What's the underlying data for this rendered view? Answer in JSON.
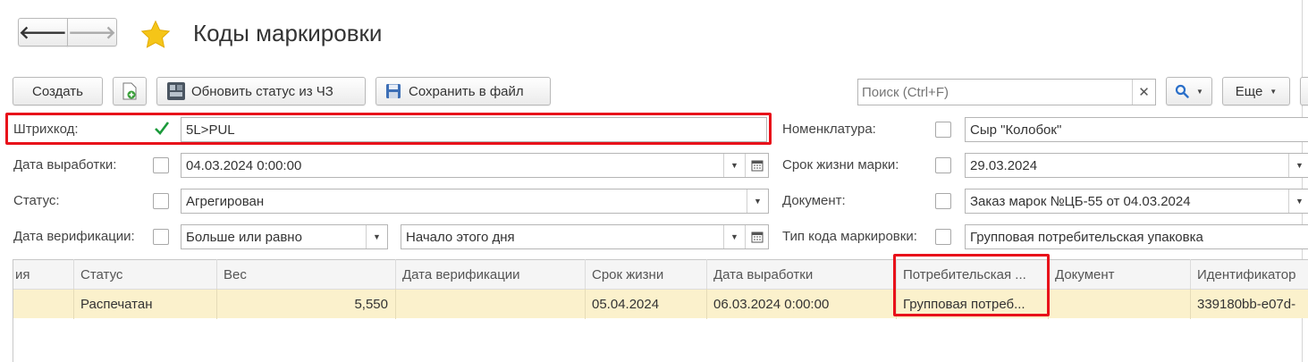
{
  "window": {
    "title": "Коды маркировки"
  },
  "nav": {
    "back": "🡐",
    "forward": "🡒"
  },
  "toolbar": {
    "create_label": "Создать",
    "update_status_label": "Обновить статус из ЧЗ",
    "save_file_label": "Сохранить в файл",
    "search_placeholder": "Поиск (Ctrl+F)",
    "more_label": "Еще"
  },
  "filters": {
    "barcode": {
      "label": "Штрихкод:",
      "value": "5L>PUL",
      "checked": true
    },
    "production_date": {
      "label": "Дата выработки:",
      "value": "04.03.2024  0:00:00"
    },
    "status": {
      "label": "Статус:",
      "value": "Агрегирован"
    },
    "verification_date": {
      "label": "Дата верификации:",
      "condition": "Больше или равно",
      "value": "Начало этого дня"
    },
    "nomenclature": {
      "label": "Номенклатура:",
      "value": "Сыр \"Колобок\""
    },
    "mark_life": {
      "label": "Срок жизни марки:",
      "value": "29.03.2024"
    },
    "document": {
      "label": "Документ:",
      "value": "Заказ марок №ЦБ-55 от 04.03.2024"
    },
    "code_type": {
      "label": "Тип кода маркировки:",
      "value": "Групповая потребительская упаковка"
    }
  },
  "table": {
    "columns": [
      "ия",
      "Статус",
      "Вес",
      "Дата верификации",
      "Срок жизни",
      "Дата выработки",
      "Потребительская ...",
      "Документ",
      "Идентификатор"
    ],
    "rows": [
      [
        "",
        "Распечатан",
        "5,550",
        "",
        "05.04.2024",
        "06.03.2024 0:00:00",
        "Групповая потреб...",
        "",
        "339180bb-e07d-"
      ]
    ]
  },
  "colors": {
    "highlight_red": "#e8111a",
    "selected_row": "#fbf1cc",
    "star": "#f5c518"
  }
}
